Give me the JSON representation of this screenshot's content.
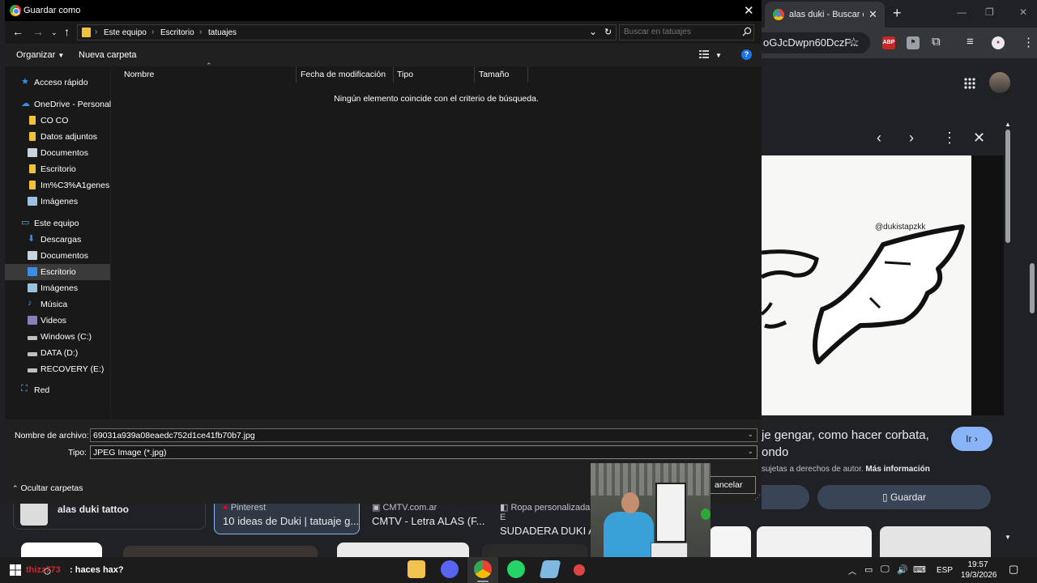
{
  "dialog": {
    "title": "Guardar como",
    "breadcrumb": [
      "Este equipo",
      "Escritorio",
      "tatuajes"
    ],
    "search_placeholder": "Buscar en tatuajes",
    "toolbar": {
      "organize": "Organizar",
      "new_folder": "Nueva carpeta"
    },
    "columns": [
      "Nombre",
      "Fecha de modificación",
      "Tipo",
      "Tamaño"
    ],
    "empty_message": "Ningún elemento coincide con el criterio de búsqueda.",
    "nav_items": [
      {
        "label": "Acceso rápido",
        "icon": "star-icon"
      },
      {
        "label": "OneDrive - Personal",
        "icon": "cloud-icon"
      },
      {
        "label": "CO CO",
        "icon": "folder-icon"
      },
      {
        "label": "Datos adjuntos",
        "icon": "folder-icon"
      },
      {
        "label": "Documentos",
        "icon": "document-icon"
      },
      {
        "label": "Escritorio",
        "icon": "folder-icon"
      },
      {
        "label": "Im%C3%A1genes",
        "icon": "folder-icon"
      },
      {
        "label": "Imágenes",
        "icon": "image-icon"
      },
      {
        "label": "Este equipo",
        "icon": "computer-icon"
      },
      {
        "label": "Descargas",
        "icon": "download-icon"
      },
      {
        "label": "Documentos",
        "icon": "document-icon"
      },
      {
        "label": "Escritorio",
        "icon": "desktop-icon"
      },
      {
        "label": "Imágenes",
        "icon": "image-icon"
      },
      {
        "label": "Música",
        "icon": "music-icon"
      },
      {
        "label": "Videos",
        "icon": "video-icon"
      },
      {
        "label": "Windows (C:)",
        "icon": "drive-icon"
      },
      {
        "label": "DATA (D:)",
        "icon": "drive-icon"
      },
      {
        "label": "RECOVERY (E:)",
        "icon": "drive-icon"
      },
      {
        "label": "Red",
        "icon": "network-icon"
      }
    ],
    "selected_nav": "Escritorio",
    "filename_label": "Nombre de archivo:",
    "filename_value": "69031a939a08eaedc752d1ce41fb70b7.jpg",
    "type_label": "Tipo:",
    "type_value": "JPEG Image (*.jpg)",
    "hide_folders": "Ocultar carpetas",
    "cancel": "Cancelar",
    "cancel_visible": "ancelar"
  },
  "browser": {
    "tab_title": "alas duki - Buscar con Google",
    "omnibox_fragment": "oGJcDwpn60DczF...",
    "ext_abp": "ABP",
    "preview_handle": "@dukistapzkk",
    "result_title": "je gengar, como hacer corbata, ondo",
    "ir_button": "Ir",
    "rights_prefix": "sujetas a derechos de autor.",
    "rights_link": "Más información",
    "save_button": "Guardar",
    "results": [
      {
        "source": "",
        "title": "alas duki tattoo"
      },
      {
        "source": "Pinterest",
        "title": "10 ideas de Duki | tatuaje g..."
      },
      {
        "source": "CMTV.com.ar",
        "title": "CMTV - Letra ALAS (F..."
      },
      {
        "source": "Ropa personalizada E",
        "title": "SUDADERA DUKI AL"
      }
    ]
  },
  "taskbar": {
    "search_user": "thizz773",
    "search_text": ": haces hax?",
    "language": "ESP",
    "time": "19:57",
    "date": "19/3/2026"
  },
  "colors": {
    "dialog_bg": "#202020",
    "pane_bg": "#191919",
    "selection": "#3a3a3a",
    "chrome_bg": "#202124",
    "accent_blue": "#8ab4f8",
    "folder_yellow": "#f0c23b"
  }
}
